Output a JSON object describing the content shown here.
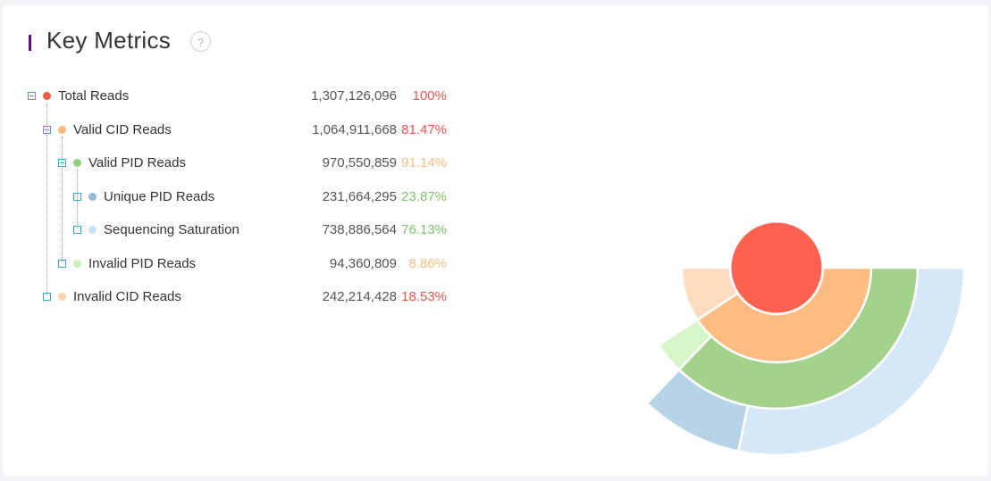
{
  "header": {
    "title": "Key Metrics",
    "help_label": "?"
  },
  "tree": [
    {
      "label": "Total Reads",
      "value": "1,307,126,096",
      "percent": "100%",
      "color": "#f05a4b",
      "pct_color": "#ef5350"
    },
    {
      "label": "Valid CID Reads",
      "value": "1,064,911,668",
      "percent": "81.47%",
      "color": "#ffb97f",
      "pct_color": "#ef5350"
    },
    {
      "label": "Valid PID Reads",
      "value": "970,550,859",
      "percent": "91.14%",
      "color": "#92cf7e",
      "pct_color": "#ffb97f"
    },
    {
      "label": "Unique PID Reads",
      "value": "231,664,295",
      "percent": "23.87%",
      "color": "#94bbda",
      "pct_color": "#7dc46a"
    },
    {
      "label": "Sequencing Saturation",
      "value": "738,886,564",
      "percent": "76.13%",
      "color": "#c9e3f7",
      "pct_color": "#7dc46a"
    },
    {
      "label": "Invalid PID Reads",
      "value": "94,360,809",
      "percent": "8.86%",
      "color": "#c8f0b8",
      "pct_color": "#ffb97f"
    },
    {
      "label": "Invalid CID Reads",
      "value": "242,214,428",
      "percent": "18.53%",
      "color": "#ffd2aa",
      "pct_color": "#ef5350"
    }
  ],
  "chart_data": {
    "type": "sunburst",
    "total": 1307126096,
    "start_angle_deg": 0,
    "span_deg": 180,
    "direction": "clockwise",
    "rings": [
      [
        {
          "name": "Total Reads",
          "value": 1307126096,
          "color": "#ff6150"
        }
      ],
      [
        {
          "name": "Valid CID Reads",
          "value": 1064911668,
          "color": "#ffbc80"
        },
        {
          "name": "Invalid CID Reads",
          "value": 242214428,
          "color": "#ffdcbf"
        }
      ],
      [
        {
          "name": "Valid PID Reads",
          "value": 970550859,
          "color": "#a3d28a"
        },
        {
          "name": "Invalid PID Reads",
          "value": 94360809,
          "color": "#d5f6c6"
        }
      ],
      [
        {
          "name": "Sequencing Saturation",
          "value": 738886564,
          "color": "#d4e8f8"
        },
        {
          "name": "Unique PID Reads",
          "value": 231664295,
          "color": "#b7d3e8"
        }
      ]
    ]
  }
}
